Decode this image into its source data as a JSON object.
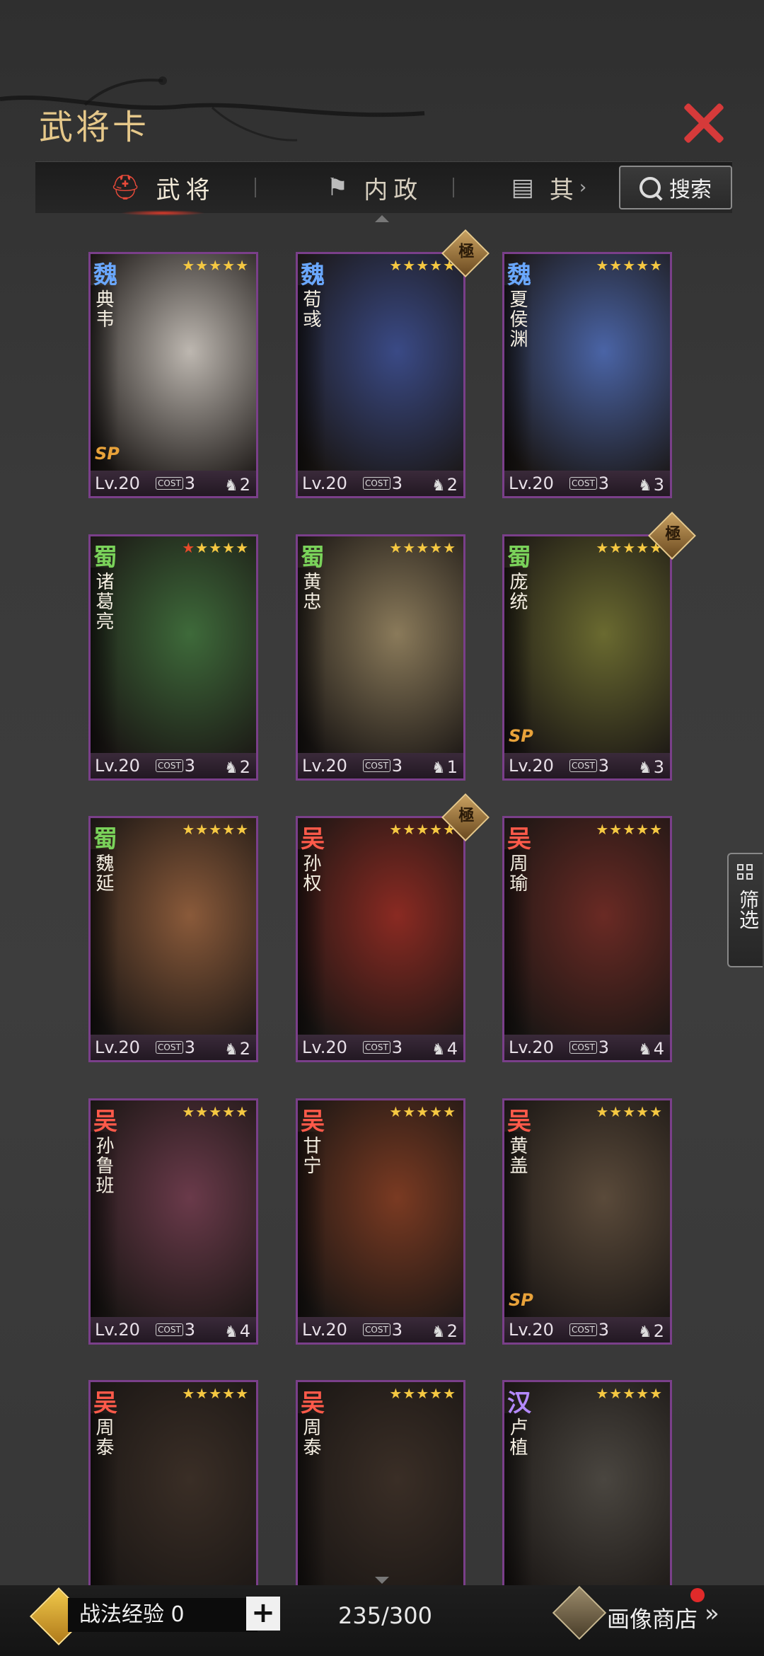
{
  "title": "武将卡",
  "tabs": [
    {
      "label": "武将",
      "icon": "helmet-icon"
    },
    {
      "label": "内政",
      "icon": "flag-icon"
    },
    {
      "label": "其",
      "icon": "book-icon"
    }
  ],
  "search_label": "搜索",
  "filter_label": "筛选",
  "cards": [
    {
      "kingdom": "魏",
      "kingdom_color": "#6aa8ff",
      "name": "典韦",
      "level": "Lv.20",
      "cost": "3",
      "unit_count": "2",
      "stars": 5,
      "red_stars": 0,
      "elite": false,
      "sp": true,
      "bg": "#bdb7b0"
    },
    {
      "kingdom": "魏",
      "kingdom_color": "#6aa8ff",
      "name": "荀彧",
      "level": "Lv.20",
      "cost": "3",
      "unit_count": "2",
      "stars": 5,
      "red_stars": 0,
      "elite": true,
      "sp": false,
      "bg": "#3a4a86"
    },
    {
      "kingdom": "魏",
      "kingdom_color": "#6aa8ff",
      "name": "夏侯渊",
      "level": "Lv.20",
      "cost": "3",
      "unit_count": "3",
      "stars": 5,
      "red_stars": 0,
      "elite": false,
      "sp": false,
      "bg": "#4a64a6"
    },
    {
      "kingdom": "蜀",
      "kingdom_color": "#7ad25a",
      "name": "诸葛亮",
      "level": "Lv.20",
      "cost": "3",
      "unit_count": "2",
      "stars": 5,
      "red_stars": 1,
      "elite": false,
      "sp": false,
      "bg": "#3e6a3a"
    },
    {
      "kingdom": "蜀",
      "kingdom_color": "#7ad25a",
      "name": "黄忠",
      "level": "Lv.20",
      "cost": "3",
      "unit_count": "1",
      "stars": 5,
      "red_stars": 0,
      "elite": false,
      "sp": false,
      "bg": "#8a7a5a"
    },
    {
      "kingdom": "蜀",
      "kingdom_color": "#7ad25a",
      "name": "庞统",
      "level": "Lv.20",
      "cost": "3",
      "unit_count": "3",
      "stars": 5,
      "red_stars": 0,
      "elite": true,
      "sp": true,
      "bg": "#6a6a30"
    },
    {
      "kingdom": "蜀",
      "kingdom_color": "#7ad25a",
      "name": "魏延",
      "level": "Lv.20",
      "cost": "3",
      "unit_count": "2",
      "stars": 5,
      "red_stars": 0,
      "elite": false,
      "sp": false,
      "bg": "#8a5a3a"
    },
    {
      "kingdom": "吴",
      "kingdom_color": "#ff5a4a",
      "name": "孙权",
      "level": "Lv.20",
      "cost": "3",
      "unit_count": "4",
      "stars": 5,
      "red_stars": 0,
      "elite": true,
      "sp": false,
      "bg": "#8a2a22"
    },
    {
      "kingdom": "吴",
      "kingdom_color": "#ff5a4a",
      "name": "周瑜",
      "level": "Lv.20",
      "cost": "3",
      "unit_count": "4",
      "stars": 5,
      "red_stars": 0,
      "elite": false,
      "sp": false,
      "bg": "#6a2a24"
    },
    {
      "kingdom": "吴",
      "kingdom_color": "#ff5a4a",
      "name": "孙鲁班",
      "level": "Lv.20",
      "cost": "3",
      "unit_count": "4",
      "stars": 5,
      "red_stars": 0,
      "elite": false,
      "sp": false,
      "bg": "#6a3a4a"
    },
    {
      "kingdom": "吴",
      "kingdom_color": "#ff5a4a",
      "name": "甘宁",
      "level": "Lv.20",
      "cost": "3",
      "unit_count": "2",
      "stars": 5,
      "red_stars": 0,
      "elite": false,
      "sp": false,
      "bg": "#7a3a22"
    },
    {
      "kingdom": "吴",
      "kingdom_color": "#ff5a4a",
      "name": "黄盖",
      "level": "Lv.20",
      "cost": "3",
      "unit_count": "2",
      "stars": 5,
      "red_stars": 0,
      "elite": false,
      "sp": true,
      "bg": "#5a4a3a"
    },
    {
      "kingdom": "吴",
      "kingdom_color": "#ff5a4a",
      "name": "周泰",
      "level": "",
      "cost": "",
      "unit_count": "",
      "stars": 5,
      "red_stars": 0,
      "elite": false,
      "sp": false,
      "bg": "#3a2e26"
    },
    {
      "kingdom": "吴",
      "kingdom_color": "#ff5a4a",
      "name": "周泰",
      "level": "",
      "cost": "",
      "unit_count": "",
      "stars": 5,
      "red_stars": 0,
      "elite": false,
      "sp": false,
      "bg": "#3a2e26"
    },
    {
      "kingdom": "汉",
      "kingdom_color": "#b48aff",
      "name": "卢植",
      "level": "",
      "cost": "",
      "unit_count": "",
      "stars": 5,
      "red_stars": 0,
      "elite": false,
      "sp": false,
      "bg": "#4a4640"
    }
  ],
  "elite_label": "極",
  "sp_label": "SP",
  "cost_label": "COST",
  "tactic_exp_label": "战法经验 0",
  "plus_label": "+",
  "card_count": "235/300",
  "shop_label": "画像商店",
  "shop_more": "»"
}
